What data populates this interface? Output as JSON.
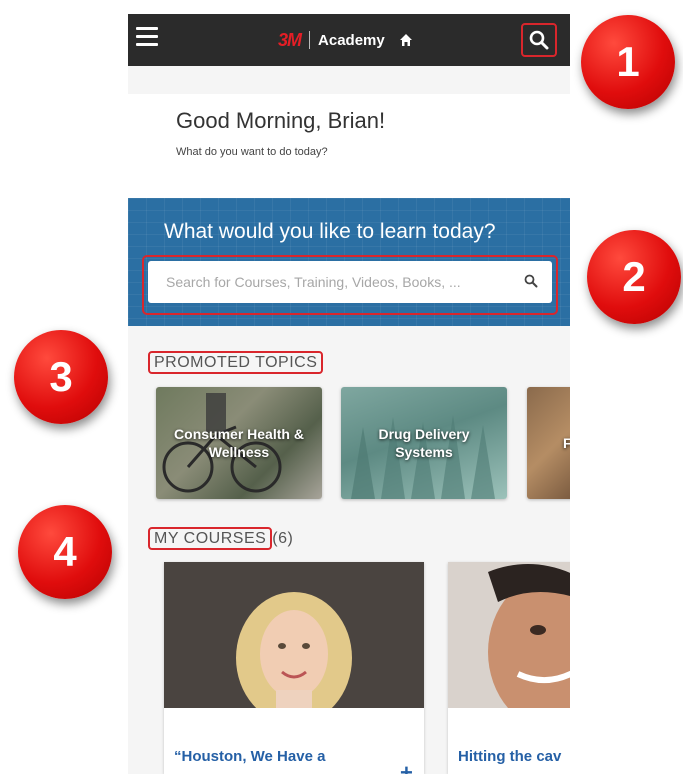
{
  "header": {
    "brand_logo": "3M",
    "brand_name": "Academy"
  },
  "greeting": {
    "title": "Good Morning, Brian!",
    "subtitle": "What do you want to do today?"
  },
  "hero": {
    "title": "What would you like to learn today?",
    "search_placeholder": "Search for Courses, Training, Videos, Books, ..."
  },
  "promoted_topics": {
    "label": "PROMOTED TOPICS",
    "items": [
      {
        "label": "Consumer Health & Wellness"
      },
      {
        "label": "Drug Delivery Systems"
      },
      {
        "label": "F"
      }
    ]
  },
  "my_courses": {
    "label": "MY COURSES",
    "count": "(6)",
    "items": [
      {
        "title": "“Houston, We Have a"
      },
      {
        "title": "Hitting the cav"
      }
    ]
  },
  "markers": [
    "1",
    "2",
    "3",
    "4"
  ],
  "colors": {
    "topbar": "#2b2b2b",
    "brand_red": "#e41e26",
    "hero_blue": "#2b6fa3",
    "highlight_red": "#d9262c",
    "course_title_blue": "#2560a6"
  }
}
